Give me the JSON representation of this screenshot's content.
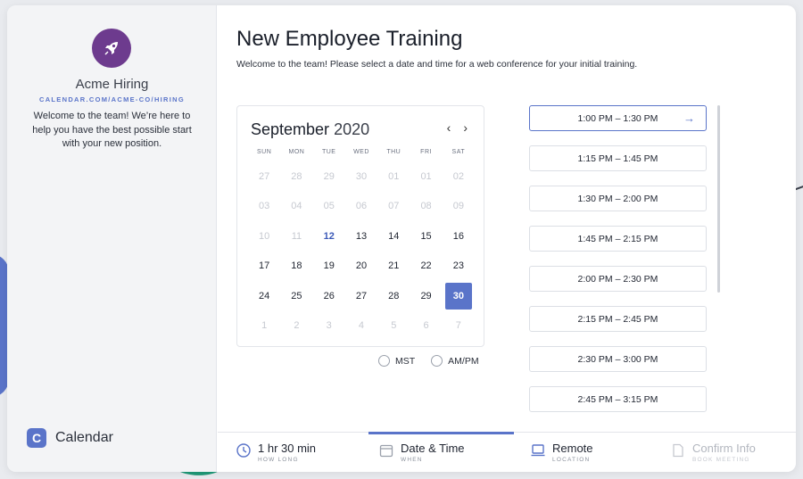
{
  "sidebar": {
    "org_name": "Acme Hiring",
    "org_url": "CALENDAR.COM/ACME-CO/HIRING",
    "description": "Welcome to the team! We’re here to help you have the best possible start with your new position.",
    "brand_name": "Calendar",
    "brand_letter": "C"
  },
  "header": {
    "title": "New Employee Training",
    "subtitle": "Welcome to the team! Please select a date and time for a web conference for your initial training."
  },
  "calendar": {
    "month": "September",
    "year": "2020",
    "prev": "‹",
    "next": "›",
    "weekdays": [
      "SUN",
      "MON",
      "TUE",
      "WED",
      "THU",
      "FRI",
      "SAT"
    ],
    "days": [
      {
        "label": "27",
        "state": "muted"
      },
      {
        "label": "28",
        "state": "muted"
      },
      {
        "label": "29",
        "state": "muted"
      },
      {
        "label": "30",
        "state": "muted"
      },
      {
        "label": "01",
        "state": "muted"
      },
      {
        "label": "01",
        "state": "muted"
      },
      {
        "label": "02",
        "state": "muted"
      },
      {
        "label": "03",
        "state": "muted"
      },
      {
        "label": "04",
        "state": "muted"
      },
      {
        "label": "05",
        "state": "muted"
      },
      {
        "label": "06",
        "state": "muted"
      },
      {
        "label": "07",
        "state": "muted"
      },
      {
        "label": "08",
        "state": "muted"
      },
      {
        "label": "09",
        "state": "muted"
      },
      {
        "label": "10",
        "state": "muted"
      },
      {
        "label": "11",
        "state": "muted"
      },
      {
        "label": "12",
        "state": "today"
      },
      {
        "label": "13",
        "state": "normal"
      },
      {
        "label": "14",
        "state": "normal"
      },
      {
        "label": "15",
        "state": "normal"
      },
      {
        "label": "16",
        "state": "normal"
      },
      {
        "label": "17",
        "state": "normal"
      },
      {
        "label": "18",
        "state": "normal"
      },
      {
        "label": "19",
        "state": "normal"
      },
      {
        "label": "20",
        "state": "normal"
      },
      {
        "label": "21",
        "state": "normal"
      },
      {
        "label": "22",
        "state": "normal"
      },
      {
        "label": "23",
        "state": "normal"
      },
      {
        "label": "24",
        "state": "normal"
      },
      {
        "label": "25",
        "state": "normal"
      },
      {
        "label": "26",
        "state": "normal"
      },
      {
        "label": "27",
        "state": "normal"
      },
      {
        "label": "28",
        "state": "normal"
      },
      {
        "label": "29",
        "state": "normal"
      },
      {
        "label": "30",
        "state": "selected"
      },
      {
        "label": "1",
        "state": "muted"
      },
      {
        "label": "2",
        "state": "muted"
      },
      {
        "label": "3",
        "state": "muted"
      },
      {
        "label": "4",
        "state": "muted"
      },
      {
        "label": "5",
        "state": "muted"
      },
      {
        "label": "6",
        "state": "muted"
      },
      {
        "label": "7",
        "state": "muted"
      }
    ],
    "timezone": "MST",
    "time_format": "AM/PM"
  },
  "slots": [
    "1:00 PM – 1:30 PM",
    "1:15 PM – 1:45 PM",
    "1:30 PM – 2:00 PM",
    "1:45 PM – 2:15 PM",
    "2:00 PM – 2:30 PM",
    "2:15 PM – 2:45 PM",
    "2:30 PM – 3:00 PM",
    "2:45 PM – 3:15 PM"
  ],
  "steps": {
    "duration": {
      "label": "1 hr 30 min",
      "sub": "HOW LONG"
    },
    "datetime": {
      "label": "Date & Time",
      "sub": "WHEN"
    },
    "location": {
      "label": "Remote",
      "sub": "LOCATION"
    },
    "confirm": {
      "label": "Confirm Info",
      "sub": "BOOK MEETING"
    }
  },
  "colors": {
    "accent": "#5a74c9",
    "avatar": "#6d3b8e"
  }
}
